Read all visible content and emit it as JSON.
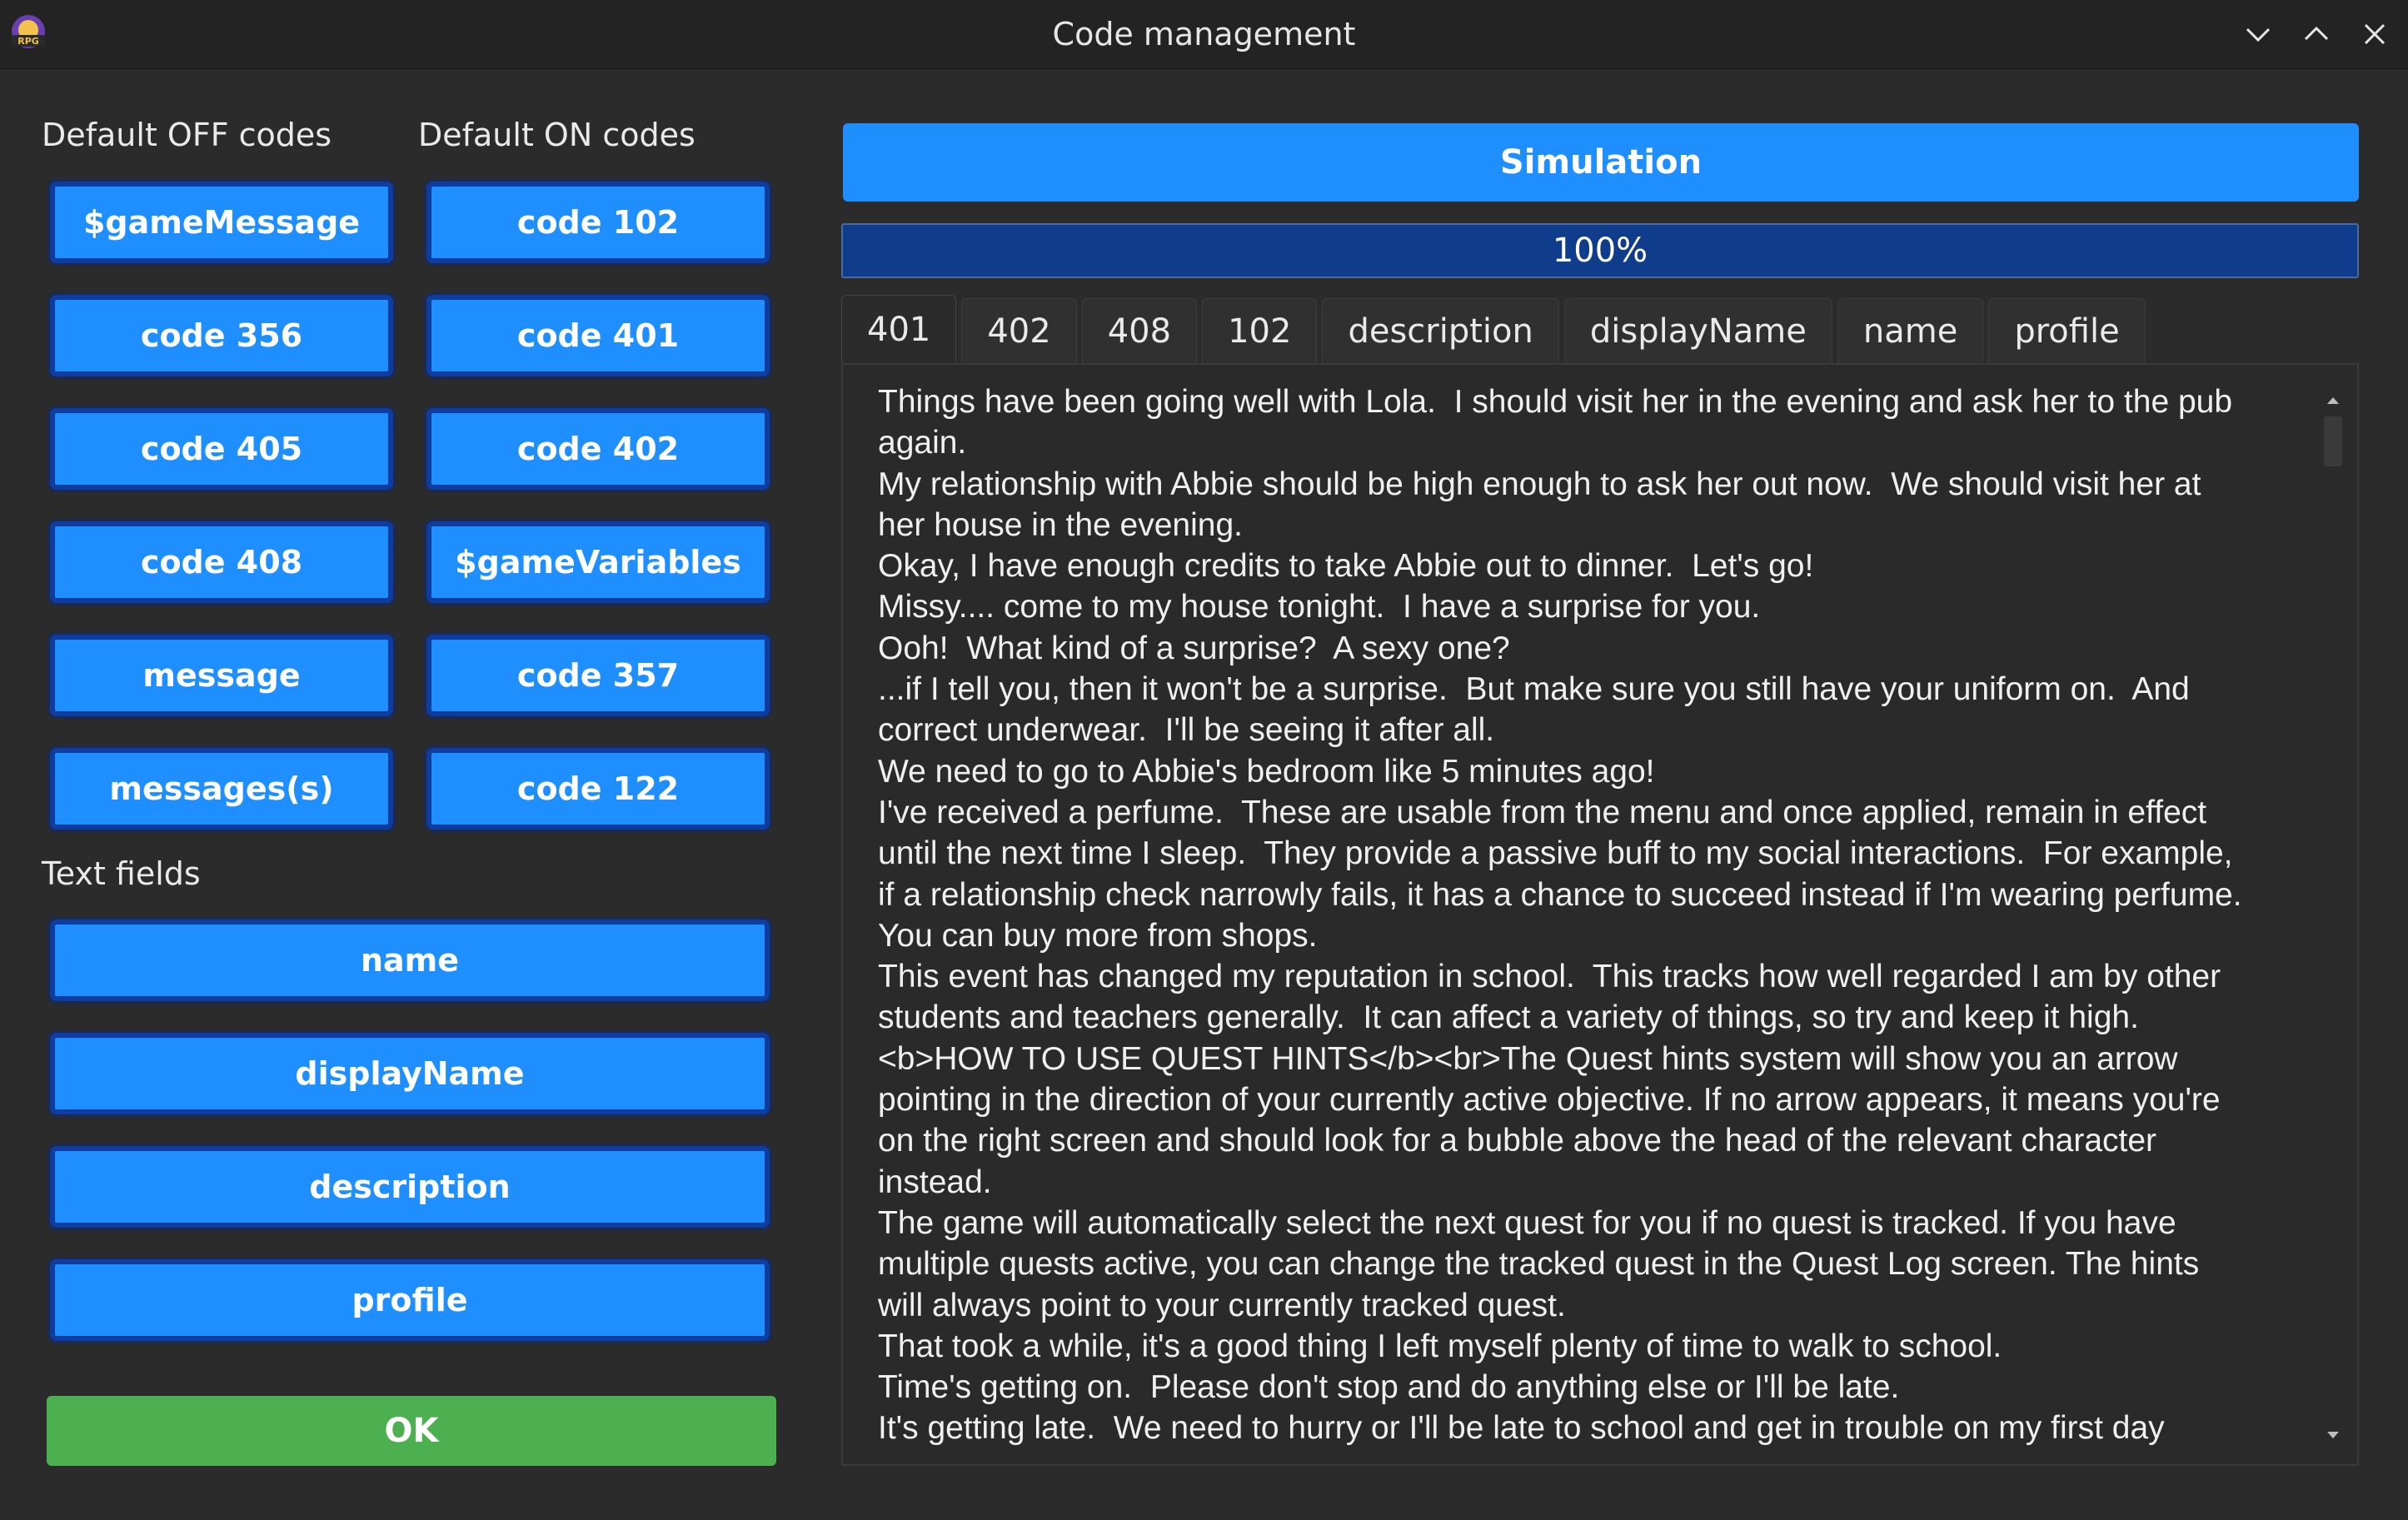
{
  "window": {
    "title": "Code management",
    "app_icon_label": "RPG"
  },
  "left": {
    "off_label": "Default OFF codes",
    "on_label": "Default ON codes",
    "off_codes": [
      "$gameMessage",
      "code 356",
      "code 405",
      "code 408",
      "message",
      "messages(s)"
    ],
    "on_codes": [
      "code 102",
      "code 401",
      "code 402",
      "$gameVariables",
      "code 357",
      "code 122"
    ],
    "text_fields_label": "Text fields",
    "text_fields": [
      "name",
      "displayName",
      "description",
      "profile"
    ],
    "ok_label": "OK"
  },
  "right": {
    "simulation_label": "Simulation",
    "progress": {
      "value": 1.0,
      "text": "100%"
    },
    "tabs": [
      "401",
      "402",
      "408",
      "102",
      "description",
      "displayName",
      "name",
      "profile"
    ],
    "active_tab": "401",
    "lines": [
      "Things have been going well with Lola.  I should visit her in the evening and ask her to the pub",
      "again.",
      "My relationship with Abbie should be high enough to ask her out now.  We should visit her at",
      "her house in the evening.",
      "Okay, I have enough credits to take Abbie out to dinner.  Let's go!",
      "Missy.... come to my house tonight.  I have a surprise for you.",
      "Ooh!  What kind of a surprise?  A sexy one?",
      "...if I tell you, then it won't be a surprise.  But make sure you still have your uniform on.  And",
      "correct underwear.  I'll be seeing it after all.",
      "We need to go to Abbie's bedroom like 5 minutes ago!",
      "I've received a perfume.  These are usable from the menu and once applied, remain in effect",
      "until the next time I sleep.  They provide a passive buff to my social interactions.  For example,",
      "if a relationship check narrowly fails, it has a chance to succeed instead if I'm wearing perfume.",
      "You can buy more from shops.",
      "This event has changed my reputation in school.  This tracks how well regarded I am by other",
      "students and teachers generally.  It can affect a variety of things, so try and keep it high.",
      "<b>HOW TO USE QUEST HINTS</b><br>The Quest hints system will show you an arrow",
      "pointing in the direction of your currently active objective. If no arrow appears, it means you're",
      "on the right screen and should look for a bubble above the head of the relevant character",
      "instead.",
      "The game will automatically select the next quest for you if no quest is tracked. If you have",
      "multiple quests active, you can change the tracked quest in the Quest Log screen. The hints",
      "will always point to your currently tracked quest.",
      "That took a while, it's a good thing I left myself plenty of time to walk to school.",
      "Time's getting on.  Please don't stop and do anything else or I'll be late.",
      "It's getting late.  We need to hurry or I'll be late to school and get in trouble on my first day"
    ]
  },
  "colors": {
    "background": "#2b2b2b",
    "button_blue": "#1f8fff",
    "button_border": "#0d3d9e",
    "ok_green": "#4caf50",
    "progress_fill": "#103c8c"
  },
  "icons": {
    "minimize": "chevron-down-icon",
    "maximize": "chevron-up-icon",
    "close": "close-icon",
    "app": "rpg-maker-icon"
  }
}
